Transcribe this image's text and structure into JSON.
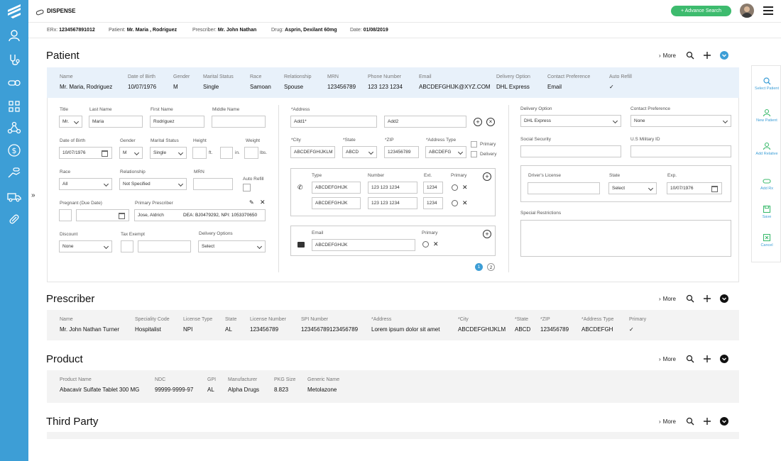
{
  "app": {
    "title": "DISPENSE",
    "advance_search": "Advance Search"
  },
  "context": {
    "erx_label": "ERx:",
    "erx": "1234567891012",
    "patient_label": "Patient:",
    "patient": "Mr. Maria , Rodriguez",
    "prescriber_label": "Prescriber:",
    "prescriber": "Mr. John Nathan",
    "drug_label": "Drug:",
    "drug": "Asprin, Dexilant 60mg",
    "date_label": "Date:",
    "date": "01/08/2019"
  },
  "more_label": "More",
  "patient": {
    "title": "Patient",
    "summary_labels": [
      "Name",
      "Date of Birth",
      "Gender",
      "Marital Status",
      "Race",
      "Relationship",
      "MRN",
      "Phone Number",
      "Email",
      "Delivery Option",
      "Contact Preference",
      "Auto Refill"
    ],
    "summary_values": [
      "Mr. Maria, Rodriguez",
      "10/07/1976",
      "M",
      "Single",
      "Samoan",
      "Spouse",
      "123456789",
      "123 123  1234",
      "ABCDEFGHIJK@XYZ.COM",
      "DHL Express",
      "Email",
      "✓"
    ],
    "form": {
      "title_label": "Title",
      "title_val": "Mr.",
      "last_name_label": "Last Name",
      "last_name": "Maria",
      "first_name_label": "First Name",
      "first_name": "Rodriguez",
      "middle_name_label": "Middle Name",
      "middle_name": "",
      "dob_label": "Date of Birth",
      "dob": "10/07/1976",
      "gender_label": "Gender",
      "gender": "M",
      "marital_label": "Marital Status",
      "marital": "Single",
      "height_label": "Height",
      "ft": "ft.",
      "in": "in.",
      "weight_label": "Weight",
      "lbs": "lbs.",
      "race_label": "Race",
      "race": "All",
      "relationship_label": "Relationship",
      "relationship": "Not Specified",
      "mrn_label": "MRN",
      "autorefill_label": "Auto Refill",
      "pregnant_label": "Pregnant (Due Date)",
      "primary_prescriber_label": "Primary Prescriber",
      "prescriber_name": "Jose, Aldrich",
      "prescriber_dea": "DEA: BJ0479292, NPI: 1053370650",
      "discount_label": "Discount",
      "discount": "None",
      "tax_label": "Tax Exempt",
      "delivery_options_label": "Delivery Options",
      "delivery_options": "Select",
      "address_label": "*Address",
      "add1": "Add1*",
      "add2": "Add2",
      "city_label": "*City",
      "city": "ABCDEFGHIJKLM",
      "state_label": "*State",
      "state": "ABCD",
      "zip_label": "*ZIP",
      "zip": "123456789",
      "addr_type_label": "*Address Type",
      "addr_type": "ABCDEFG",
      "primary_label": "Primary",
      "delivery_label": "Delivery",
      "phone_type_label": "Type",
      "phone_number_label": "Number",
      "phone_ext_label": "Ext.",
      "phone_primary_label": "Primary",
      "phones": [
        {
          "type": "ABCDEFGHIJK",
          "number": "123 123  1234",
          "ext": "1234"
        },
        {
          "type": "ABCDEFGHIJK",
          "number": "123 123  1234",
          "ext": "1234"
        }
      ],
      "email_label": "Email",
      "email": "ABCDEFGHIJK",
      "email_primary_label": "Primary",
      "pages": [
        "1",
        "2"
      ],
      "delivery_option_label": "Delivery Option",
      "delivery_option": "DHL Express",
      "contact_pref_label": "Contact Preference",
      "contact_pref": "None",
      "ssn_label": "Social Security",
      "military_label": "U.S Military ID",
      "license_label": "Driver's License",
      "lic_state_label": "State",
      "lic_state": "Select",
      "exp_label": "Exp.",
      "exp": "10/07/1976",
      "special_label": "Special Restrictions"
    }
  },
  "prescriber": {
    "title": "Prescriber",
    "labels": [
      "Name",
      "Speciality Code",
      "License Type",
      "State",
      "License Number",
      "SPI Number",
      "*Address",
      "*City",
      "*State",
      "*ZIP",
      "*Address Type",
      "Primary"
    ],
    "values": [
      "Mr. John Nathan Turner",
      "Hospitalist",
      "NPI",
      "AL",
      "123456789",
      "123456789123456789",
      "Lorem ipsum dolor sit amet",
      "ABCDEFGHIJKLM",
      "ABCD",
      "123456789",
      "ABCDEFGH",
      "✓"
    ]
  },
  "product": {
    "title": "Product",
    "labels": [
      "Product Name",
      "NDC",
      "GPI",
      "Manufacturer",
      "PKG Size",
      "Generic Name"
    ],
    "values": [
      "Abacavir Sulfate Tablet 300 MG",
      "99999-9999-97",
      "AL",
      "Alpha Drugs",
      "8.823",
      "Metolazone"
    ]
  },
  "third_party": {
    "title": "Third Party"
  },
  "right_panel": [
    "Select Patient",
    "New Patient",
    "Add Relative",
    "Add Rx",
    "Save",
    "Cancel"
  ],
  "colors": {
    "sidebar": "#3d9ed6",
    "accent_green": "#3dbb6e",
    "summary_bg": "#e8f1fa"
  }
}
